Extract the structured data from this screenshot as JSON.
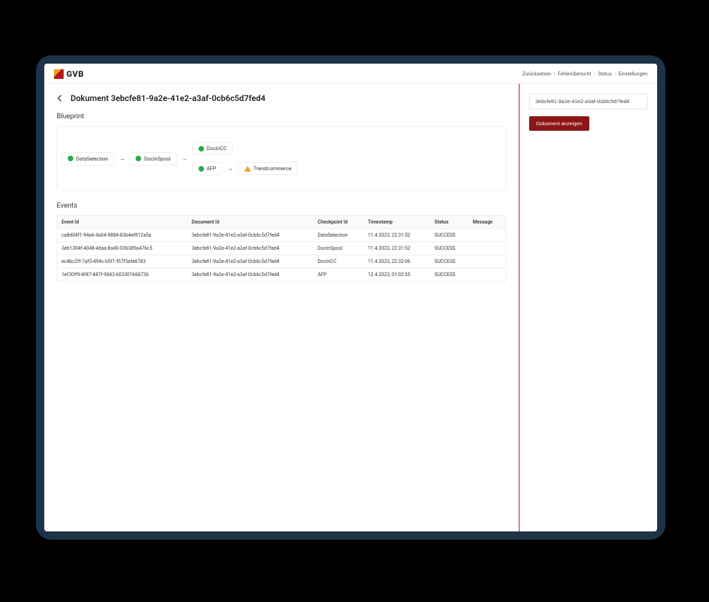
{
  "brand": {
    "name": "GVB"
  },
  "topnav": {
    "reset": "Zurücksetzen",
    "errors": "Fehlerübersicht",
    "status": "Status",
    "settings": "Einstellungen"
  },
  "page": {
    "title_prefix": "Dokument",
    "document_id": "3ebcfe81-9a2e-41e2-a3af-0cb6c5d7fed4",
    "full_title": "Dokument 3ebcfe81-9a2e-41e2-a3af-0cb6c5d7fed4"
  },
  "blueprint": {
    "heading": "Blueprint",
    "nodes": {
      "data_selection": {
        "label": "DataSelection",
        "status": "ok"
      },
      "doc_in_spool": {
        "label": "DocInSpool",
        "status": "ok"
      },
      "doc_in_cc": {
        "label": "DocInCC",
        "status": "ok"
      },
      "afp": {
        "label": "AFP",
        "status": "ok"
      },
      "trendcommerce": {
        "label": "Trendcommerce",
        "status": "warn"
      }
    }
  },
  "events": {
    "heading": "Events",
    "columns": {
      "event_id": "Event Id",
      "document_id": "Document Id",
      "checkpoint_id": "Checkpoint Id",
      "timestamp": "Timestamp",
      "status": "Status",
      "message": "Message"
    },
    "rows": [
      {
        "event_id": "ca8d04f1-94a6-4a04-9884-83b4ef812a5a",
        "document_id": "3ebcfe81-9a2e-41e2-a3af-0cb6c5d7fed4",
        "checkpoint_id": "DataSelection",
        "timestamp": "11.4.2023, 22:31:52",
        "status": "SUCCESS",
        "message": ""
      },
      {
        "event_id": "3eb1304f-4048-4daa-8a40-036389a476c5",
        "document_id": "3ebcfe81-9a2e-41e2-a3af-0cb6c5d7fed4",
        "checkpoint_id": "DocInSpool",
        "timestamp": "11.4.2023, 22:31:52",
        "status": "SUCCESS",
        "message": ""
      },
      {
        "event_id": "ec4bc2ff-7af5-494c-b5f1-f57f5afe8783",
        "document_id": "3ebcfe81-9a2e-41e2-a3af-0cb6c5d7fed4",
        "checkpoint_id": "DocInCC",
        "timestamp": "11.4.2023, 22:32:06",
        "status": "SUCCESS",
        "message": ""
      },
      {
        "event_id": "1ef30ff9-8f87-447f-9843-603301668736",
        "document_id": "3ebcfe81-9a2e-41e2-a3af-0cb6c5d7fed4",
        "checkpoint_id": "AFP",
        "timestamp": "12.4.2023, 01:02:55",
        "status": "SUCCESS",
        "message": ""
      }
    ]
  },
  "side_panel": {
    "input_value": "3ebcfe81-9a2e-41e2-a3af-0cb6c5d7fed4",
    "button_label": "Dokument anzeigen"
  },
  "colors": {
    "brand_red": "#8c1515",
    "brand_orange": "#f0a020",
    "ok_green": "#2ba84a"
  }
}
